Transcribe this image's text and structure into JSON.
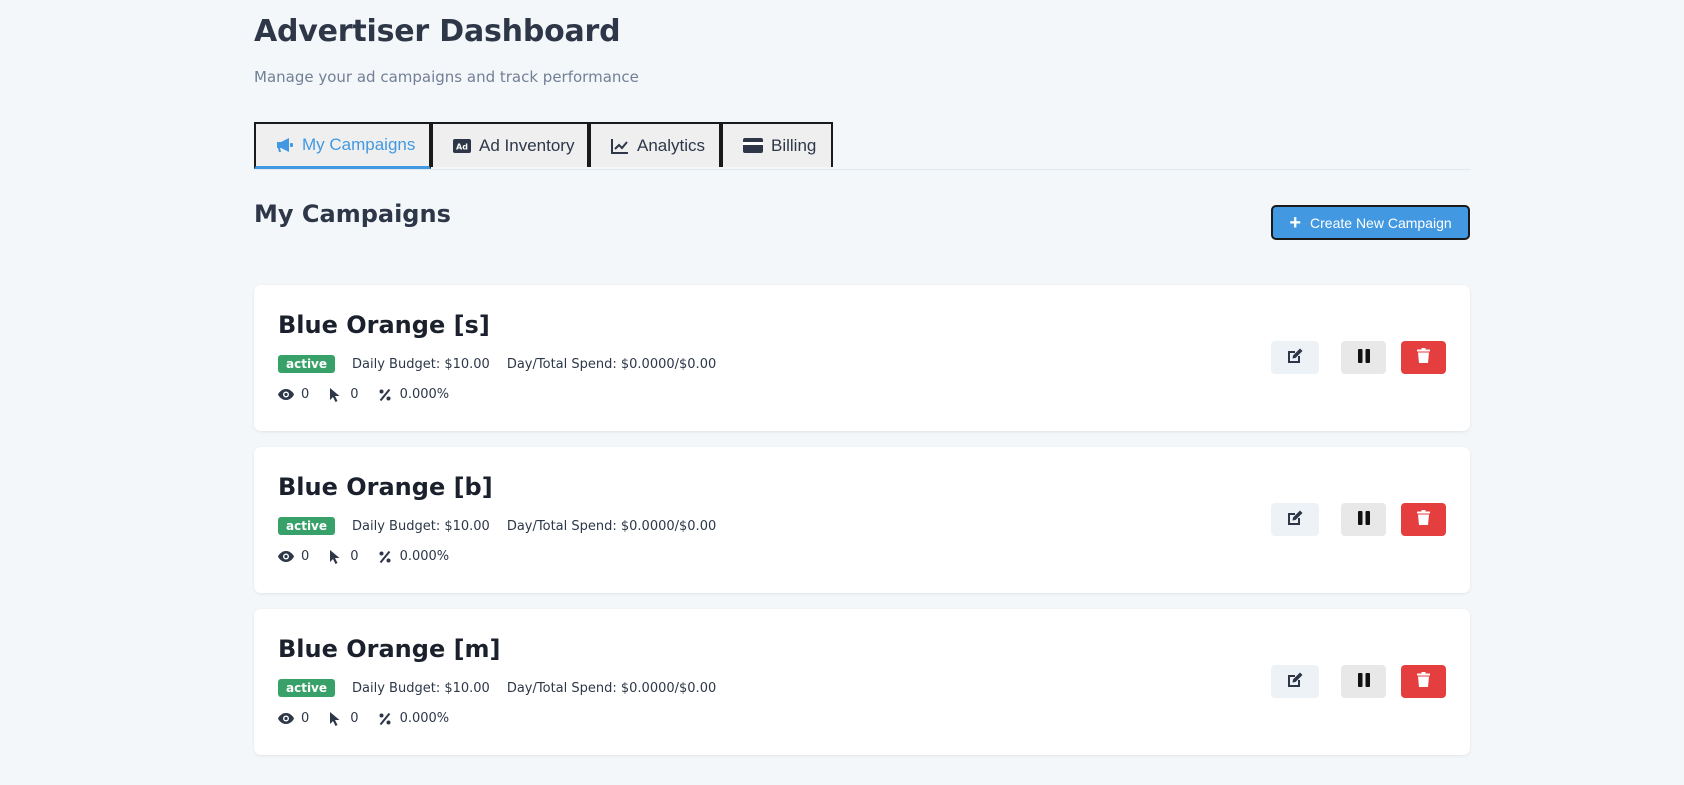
{
  "header": {
    "title": "Advertiser Dashboard",
    "subtitle": "Manage your ad campaigns and track performance"
  },
  "tabs": [
    {
      "label": "My Campaigns",
      "icon": "megaphone-icon",
      "active": true
    },
    {
      "label": "Ad Inventory",
      "icon": "ad-icon",
      "active": false
    },
    {
      "label": "Analytics",
      "icon": "chart-line-icon",
      "active": false
    },
    {
      "label": "Billing",
      "icon": "credit-card-icon",
      "active": false
    }
  ],
  "section": {
    "title": "My Campaigns",
    "create_button": "Create New Campaign"
  },
  "campaigns": [
    {
      "name": "Blue Orange [s]",
      "status": "active",
      "daily_budget": "Daily Budget: $10.00",
      "spend": "Day/Total Spend: $0.0000/$0.00",
      "impressions": "0",
      "clicks": "0",
      "ctr": "0.000%"
    },
    {
      "name": "Blue Orange [b]",
      "status": "active",
      "daily_budget": "Daily Budget: $10.00",
      "spend": "Day/Total Spend: $0.0000/$0.00",
      "impressions": "0",
      "clicks": "0",
      "ctr": "0.000%"
    },
    {
      "name": "Blue Orange [m]",
      "status": "active",
      "daily_budget": "Daily Budget: $10.00",
      "spend": "Day/Total Spend: $0.0000/$0.00",
      "impressions": "0",
      "clicks": "0",
      "ctr": "0.000%"
    }
  ],
  "colors": {
    "accent": "#4299e1",
    "active_badge": "#38a169",
    "delete": "#e53e3e",
    "background": "#f4f7fa"
  }
}
